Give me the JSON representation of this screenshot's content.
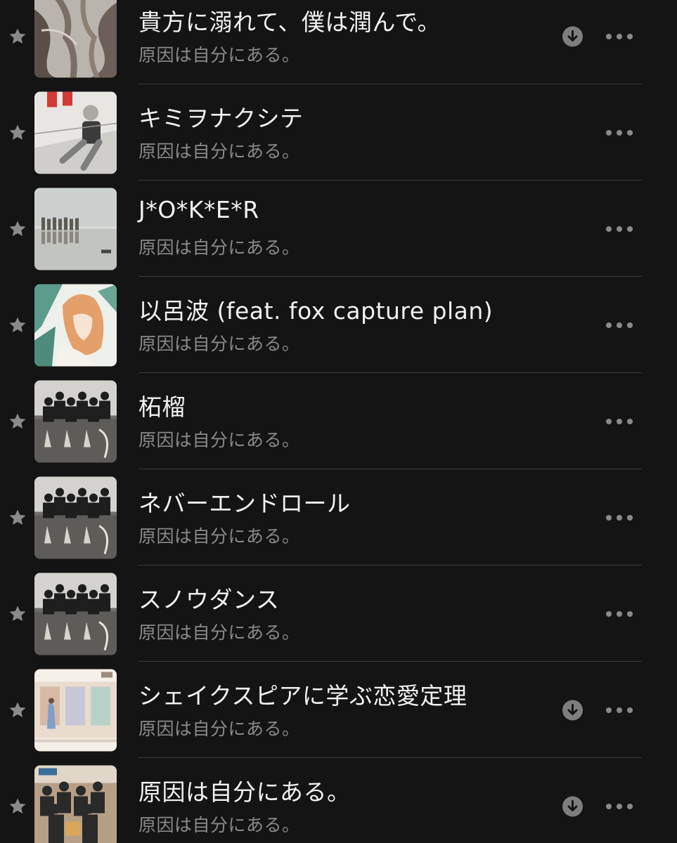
{
  "colors": {
    "background": "#141414",
    "title": "#f2f2f2",
    "subtitle": "#8a8a8a",
    "icon": "#8a8a8a",
    "separator": "#3a3a3a"
  },
  "tracks": [
    {
      "title": "貴方に溺れて、僕は潤んで。",
      "subtitle": "原因は自分にある。",
      "downloaded": true,
      "art": "art-grey-hands"
    },
    {
      "title": "キミヲナクシテ",
      "subtitle": "原因は自分にある。",
      "downloaded": false,
      "art": "art-sketch-boy"
    },
    {
      "title": "J*O*K*E*R",
      "subtitle": "原因は自分にある。",
      "downloaded": false,
      "art": "art-reflection-group"
    },
    {
      "title": "以呂波 (feat. fox capture plan)",
      "subtitle": "原因は自分にある。",
      "downloaded": false,
      "art": "art-anime-girl"
    },
    {
      "title": "柘榴",
      "subtitle": "原因は自分にある。",
      "downloaded": false,
      "art": "art-group-dark"
    },
    {
      "title": "ネバーエンドロール",
      "subtitle": "原因は自分にある。",
      "downloaded": false,
      "art": "art-group-dark"
    },
    {
      "title": "スノウダンス",
      "subtitle": "原因は自分にある。",
      "downloaded": false,
      "art": "art-group-dark"
    },
    {
      "title": "シェイクスピアに学ぶ恋愛定理",
      "subtitle": "原因は自分にある。",
      "downloaded": true,
      "art": "art-pastel-street"
    },
    {
      "title": "原因は自分にある。",
      "subtitle": "原因は自分にある。",
      "downloaded": true,
      "art": "art-group-cafe"
    }
  ]
}
